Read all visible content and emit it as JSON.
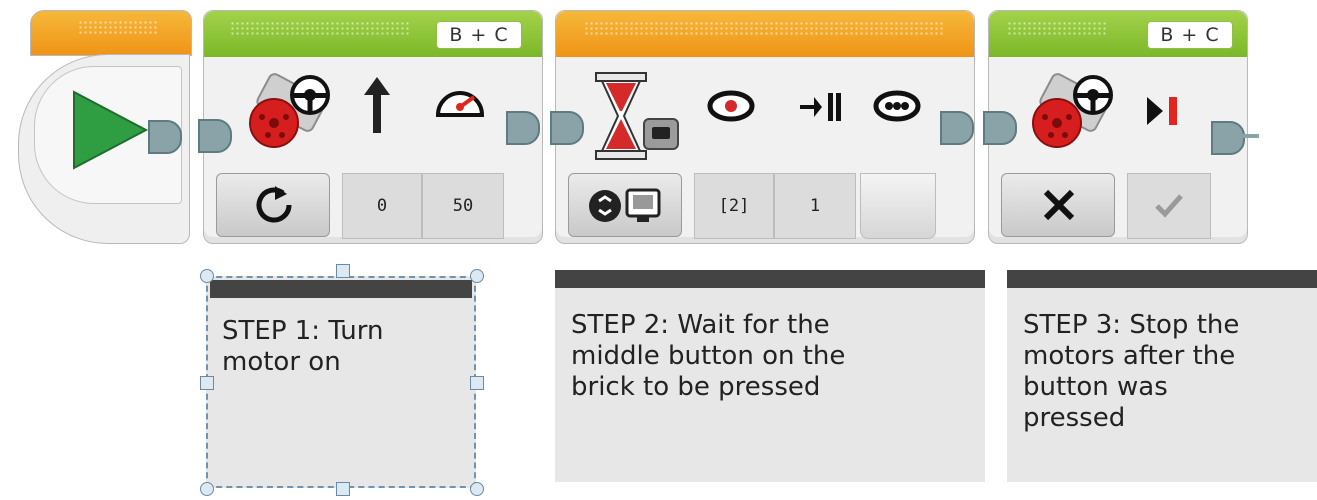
{
  "blocks": {
    "motor_on": {
      "port": "B + C",
      "params": [
        "0",
        "50"
      ],
      "mode_icon": "rotate-icon",
      "icons": [
        "large-motor-icon",
        "steering-wheel-icon",
        "direction-arrow-icon",
        "power-gauge-icon"
      ]
    },
    "wait": {
      "params": [
        "[2]",
        "1"
      ],
      "mode_icon": "brick-buttons-icon",
      "icons": [
        "hourglass-icon",
        "brick-button-icon",
        "compare-icon",
        "state-button-icon"
      ]
    },
    "motor_off": {
      "port": "B + C",
      "mode_icon": "close-icon",
      "brake_icon": "check-icon",
      "icons": [
        "large-motor-icon",
        "steering-wheel-icon",
        "stop-play-icon"
      ]
    }
  },
  "comments": [
    {
      "text": "STEP 1: Turn\nmotor on"
    },
    {
      "text": "STEP 2: Wait for the\nmiddle button on the\nbrick to be pressed"
    },
    {
      "text": "STEP 3: Stop the\nmotors after the\nbutton was\npressed"
    }
  ],
  "colors": {
    "start": "#f29a1e",
    "motor": "#86c334",
    "flow": "#f29a1e",
    "port_plug": "#8aa3a8"
  }
}
